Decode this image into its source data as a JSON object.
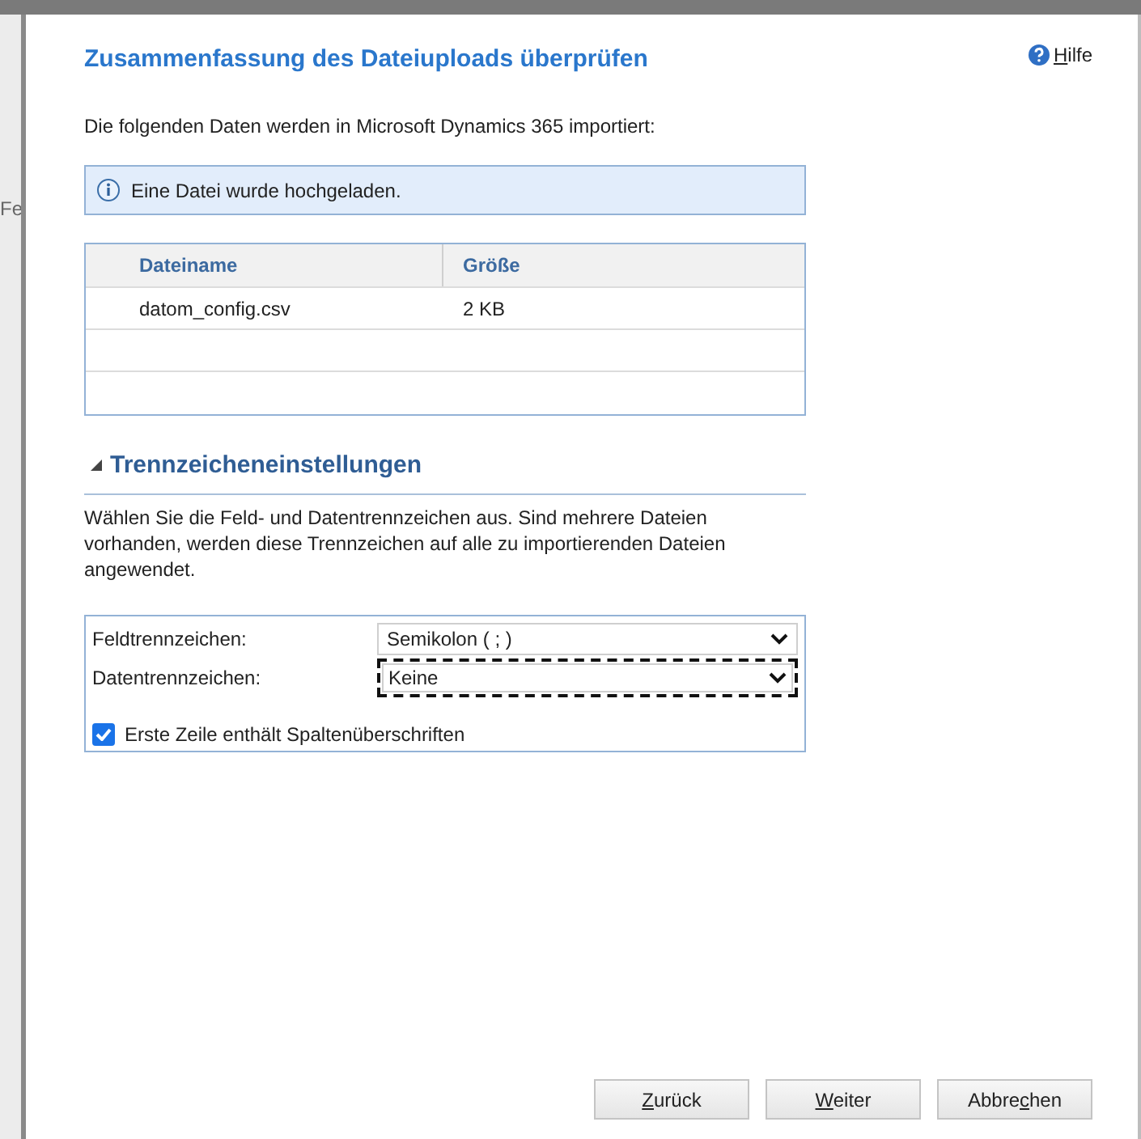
{
  "background_text": "Fe",
  "dialog": {
    "title": "Zusammenfassung des Dateiuploads überprüfen",
    "help": {
      "key": "H",
      "after": "ilfe"
    },
    "intro": "Die folgenden Daten werden in Microsoft Dynamics 365 importiert:",
    "info": "Eine Datei wurde hochgeladen.",
    "table": {
      "columns": [
        "Dateiname",
        "Größe"
      ],
      "rows": [
        [
          "datom_config.csv",
          "2 KB"
        ]
      ],
      "empty_rows": [
        "",
        ""
      ]
    },
    "section": {
      "title": "Trennzeicheneinstellungen",
      "expanded": true,
      "description": "Wählen Sie die Feld- und Datentrennzeichen aus. Sind mehrere Dateien vorhanden, werden diese Trennzeichen auf alle zu importierenden Dateien angewendet.",
      "fields": [
        {
          "label": "Feldtrennzeichen:",
          "value": "Semikolon ( ; )",
          "focused": false
        },
        {
          "label": "Datentrennzeichen:",
          "value": "Keine",
          "focused": true
        }
      ],
      "checkbox": {
        "label": "Erste Zeile enthält Spaltenüberschriften",
        "checked": true
      }
    },
    "buttons": [
      {
        "key": "Z",
        "after": "urück"
      },
      {
        "key": "W",
        "after": "eiter"
      },
      {
        "before": "Abbre",
        "key": "c",
        "after": "hen"
      }
    ]
  }
}
